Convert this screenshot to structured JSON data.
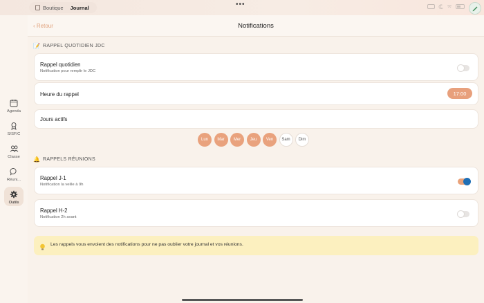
{
  "topbar": {
    "tabs": [
      {
        "label": "Boutique",
        "active": false
      },
      {
        "label": "Journal",
        "active": true
      }
    ],
    "more_dots": "•••"
  },
  "sidebar": {
    "items": [
      {
        "label": "Agenda",
        "icon": "calendar-icon"
      },
      {
        "label": "S/SF/C",
        "icon": "award-icon"
      },
      {
        "label": "Classe",
        "icon": "people-icon"
      },
      {
        "label": "Réuni...",
        "icon": "chat-icon"
      },
      {
        "label": "Outils",
        "icon": "gear-icon",
        "active": true
      }
    ]
  },
  "header": {
    "back_label": "‹ Retour",
    "title": "Notifications"
  },
  "sections": {
    "daily": {
      "title": "RAPPEL QUOTIDIEN JDC",
      "emoji": "📝",
      "reminder": {
        "label": "Rappel quotidien",
        "sub": "Notification pour remplir le JDC",
        "enabled": false
      },
      "time": {
        "label": "Heure du rappel",
        "value": "17:00"
      },
      "days": {
        "label": "Jours actifs",
        "items": [
          {
            "label": "Lun",
            "active": true
          },
          {
            "label": "Mar",
            "active": true
          },
          {
            "label": "Mer",
            "active": true
          },
          {
            "label": "Jeu",
            "active": true
          },
          {
            "label": "Ven",
            "active": true
          },
          {
            "label": "Sam",
            "active": false
          },
          {
            "label": "Dim",
            "active": false
          }
        ]
      }
    },
    "meetings": {
      "title": "RAPPELS RÉUNIONS",
      "emoji": "🔔",
      "j1": {
        "label": "Rappel J-1",
        "sub": "Notification la veille à 9h",
        "enabled": true
      },
      "h2": {
        "label": "Rappel H-2",
        "sub": "Notification 2h avant",
        "enabled": false
      }
    }
  },
  "info": {
    "text": "Les rappels vous envoient des notifications pour ne pas oublier votre journal et vos réunions."
  },
  "colors": {
    "accent": "#e9a27d",
    "toggle_on_knob": "#1f6fb5",
    "info_bg": "#fcf0bf"
  }
}
